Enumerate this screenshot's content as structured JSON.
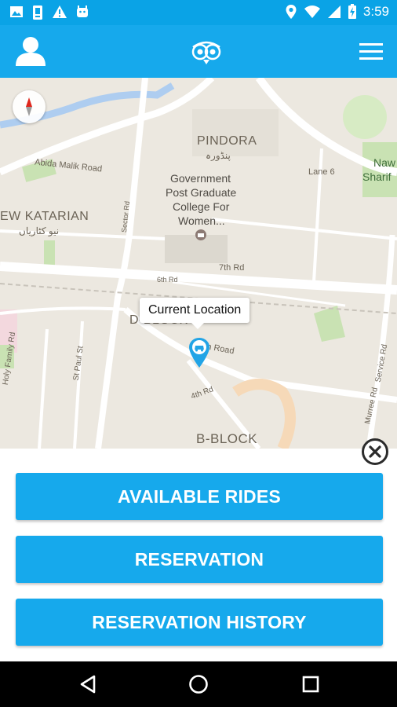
{
  "status_bar": {
    "time": "3:59",
    "left_icons": [
      "image-icon",
      "sim-card-icon",
      "warning-icon",
      "android-icon"
    ],
    "right_icons": [
      "location-icon",
      "wifi-icon",
      "signal-icon",
      "battery-charging-icon"
    ]
  },
  "app_bar": {
    "profile_icon": "user-profile-icon",
    "logo_icon": "app-logo-icon",
    "menu_icon": "hamburger-menu-icon",
    "color": "#16a9ec"
  },
  "map": {
    "labels": {
      "pindora": "PINDORA",
      "pindora_urdu": "پنڈورہ",
      "college": [
        "Government",
        "Post Graduate",
        "College For",
        "Women..."
      ],
      "katarian": "EW KATARIAN",
      "katarian_urdu": "نیو کٹاریاں",
      "abida_malik": "Abida Malik Road",
      "lane6": "Lane 6",
      "naw": "Naw",
      "sharif": "Sharif",
      "seventh": "7th Rd",
      "sixth": "6th Rd",
      "dblock": "D-BLOCK",
      "fifth": "Fifth Road",
      "fourth": "4th Rd",
      "bblock": "B-BLOCK",
      "holy_family": "Holy Family Rd",
      "st_paul": "St Paul St",
      "service": "Service Rd",
      "murree": "Murree Rd",
      "sector": "Sector Rd"
    },
    "callout": "Current Location"
  },
  "actions": {
    "available_rides": "AVAILABLE RIDES",
    "reservation": "RESERVATION",
    "reservation_history": "RESERVATION HISTORY"
  },
  "nav_bar": {
    "back_icon": "back-triangle-icon",
    "home_icon": "home-circle-icon",
    "recents_icon": "recents-square-icon"
  }
}
